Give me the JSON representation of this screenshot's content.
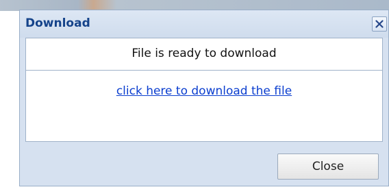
{
  "dialog": {
    "title": "Download",
    "close_icon": "close-icon",
    "message": "File is ready to download",
    "link_text": "click here to download the file",
    "close_button_label": "Close"
  },
  "colors": {
    "title_text": "#15438a",
    "link": "#0b3ecf",
    "dialog_bg": "#d6e1f0"
  }
}
